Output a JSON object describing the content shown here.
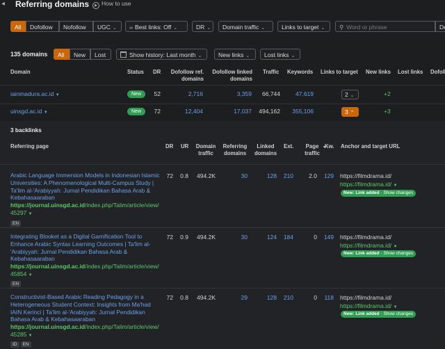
{
  "header": {
    "title": "Referring domains",
    "how_to_use": "How to use"
  },
  "filters": {
    "all": "All",
    "dofollow": "Dofollow",
    "nofollow": "Nofollow",
    "ugc": "UGC",
    "best_links": "Best links: Off",
    "dr": "DR",
    "domain_traffic": "Domain traffic",
    "links_to_target": "Links to target",
    "search_placeholder": "Word or phrase",
    "mode": "De"
  },
  "domains_toolbar": {
    "count": "135 domains",
    "all": "All",
    "new": "New",
    "lost": "Lost",
    "history": "Show history: Last month",
    "new_links": "New links",
    "lost_links": "Lost links"
  },
  "domain_columns": [
    "Domain",
    "Status",
    "DR",
    "Dofollow ref. domains",
    "Dofollow linked domains",
    "Traffic",
    "Keywords",
    "Links to target",
    "New links",
    "Lost links",
    "Dofollo"
  ],
  "domains": [
    {
      "domain": "iainmadura.ac.id",
      "status": "New",
      "dr": "52",
      "ref_domains": "2,716",
      "linked_domains": "3,359",
      "traffic": "66,744",
      "keywords": "47,619",
      "links_to_target": "2",
      "new_links": "+2",
      "expanded": false
    },
    {
      "domain": "uinsgd.ac.id",
      "status": "New",
      "dr": "72",
      "ref_domains": "12,404",
      "linked_domains": "17,037",
      "traffic": "494,162",
      "keywords": "355,106",
      "links_to_target": "3",
      "new_links": "+3",
      "expanded": true
    }
  ],
  "backlinks": {
    "count": "3 backlinks",
    "columns": [
      "Referring page",
      "DR",
      "UR",
      "Domain traffic",
      "Referring domains",
      "Linked domains",
      "Ext.",
      "Page traffic",
      "Kw.",
      "Anchor and target URL"
    ],
    "rows": [
      {
        "title": "Arabic Language Immersion Models in Indonesian Islamic Universities: A Phenomenological Multi-Campus Study | Ta'lim al-'Arabiyyah: Jurnal Pendidikan Bahasa Arab & Kebahasaaraban",
        "url_domain": "https://journal.uinsgd.ac.id",
        "url_path": "/index.php/Talim/article/view/45297",
        "langs": [
          "EN"
        ],
        "dr": "72",
        "ur": "0.8",
        "domain_traffic": "494.2K",
        "ref_domains": "30",
        "linked_domains": "128",
        "ext": "210",
        "page_traffic": "2.0",
        "kw": "129",
        "anchor": "https://filmdrama.id/",
        "target": "https://filmdrama.id/",
        "badge_new": "New: Link added",
        "badge_changes": "Show changes"
      },
      {
        "title": "Integrating Blooket as a Digital Gamification Tool to Enhance Arabic Syntax Learning Outcomes | Ta'lim al-'Arabiyyah: Jurnal Pendidikan Bahasa Arab & Kebahasaaraban",
        "url_domain": "https://journal.uinsgd.ac.id",
        "url_path": "/index.php/Talim/article/view/45854",
        "langs": [
          "EN"
        ],
        "dr": "72",
        "ur": "0.9",
        "domain_traffic": "494.2K",
        "ref_domains": "30",
        "linked_domains": "124",
        "ext": "184",
        "page_traffic": "0",
        "kw": "149",
        "anchor": "https://filmdrama.id/",
        "target": "https://filmdrama.id/",
        "badge_new": "New: Link added",
        "badge_changes": "Show changes"
      },
      {
        "title": "Constructivist-Based Arabic Reading Pedagogy in a Heterogeneous Student Context: Insights from Ma'had IAIN Kerinci | Ta'lim al-'Arabiyyah: Jurnal Pendidikan Bahasa Arab & Kebahasaaraban",
        "url_domain": "https://journal.uinsgd.ac.id",
        "url_path": "/index.php/Talim/article/view/45285",
        "langs": [
          "ID",
          "EN"
        ],
        "dr": "72",
        "ur": "0.8",
        "domain_traffic": "494.2K",
        "ref_domains": "29",
        "linked_domains": "128",
        "ext": "210",
        "page_traffic": "0",
        "kw": "118",
        "anchor": "https://filmdrama.id/",
        "target": "https://filmdrama.id/",
        "badge_new": "New: Link added",
        "badge_changes": "Show changes"
      }
    ]
  },
  "colors": {
    "accent_orange": "#c9670f",
    "link_blue": "#6aa0ec",
    "green": "#5bc86a",
    "badge_green": "#2f9e53"
  }
}
